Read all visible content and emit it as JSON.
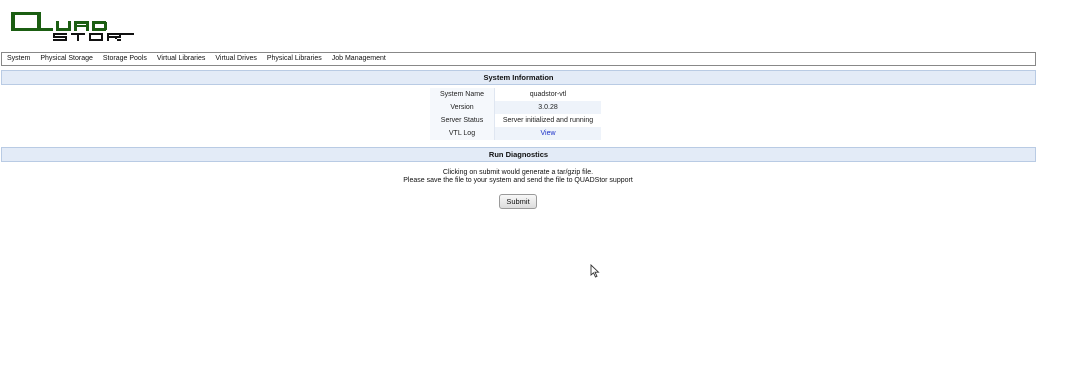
{
  "branding": {
    "logo_text": "QUADSTOR",
    "logo_color": "#1b5e12"
  },
  "menu": {
    "items": [
      {
        "label": "System"
      },
      {
        "label": "Physical Storage"
      },
      {
        "label": "Storage Pools"
      },
      {
        "label": "Virtual Libraries"
      },
      {
        "label": "Virtual Drives"
      },
      {
        "label": "Physical Libraries"
      },
      {
        "label": "Job Management"
      }
    ]
  },
  "system_information": {
    "title": "System Information",
    "rows": [
      {
        "key": "System Name",
        "value": "quadstor-vtl"
      },
      {
        "key": "Version",
        "value": "3.0.28"
      },
      {
        "key": "Server Status",
        "value": "Server initialized and running"
      },
      {
        "key": "VTL Log",
        "value": "View"
      }
    ]
  },
  "diagnostics": {
    "title": "Run Diagnostics",
    "line1": "Clicking on submit would generate a tar/gzip file.",
    "line2": "Please save the file to your system and send the file to QUADStor support",
    "submit_label": "Submit"
  },
  "colors": {
    "header_bg": "#e3ebf7",
    "link": "#1b2fc7"
  },
  "icons": {
    "cursor": "mouse-pointer-icon"
  }
}
